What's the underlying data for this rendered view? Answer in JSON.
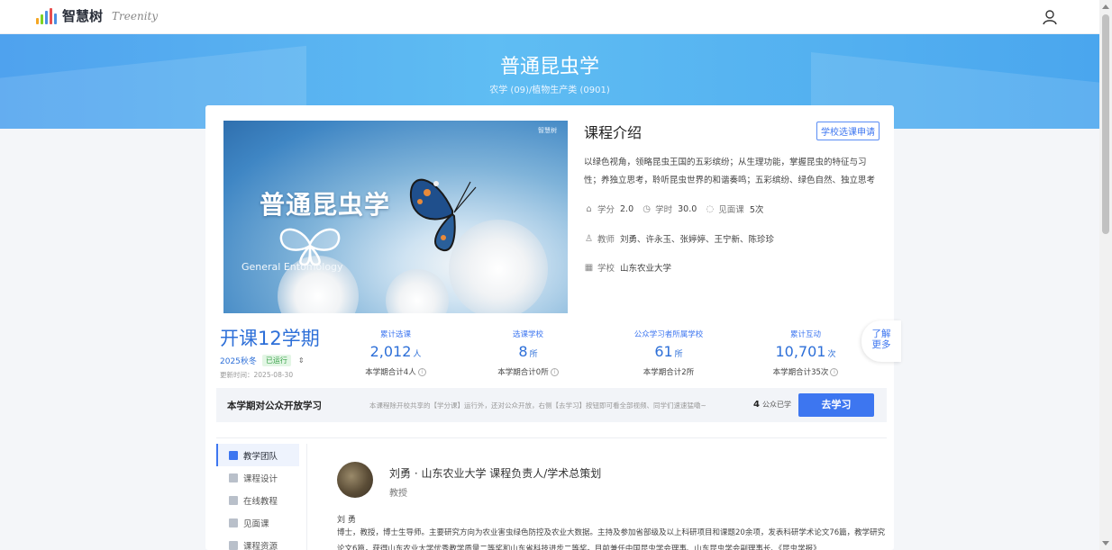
{
  "header": {
    "brand": "智慧树",
    "brand_sub": "Treenity",
    "logo_bar_colors": [
      "#f5a623",
      "#7ed321",
      "#4a90e2",
      "#e94e4e",
      "#4a90e2"
    ]
  },
  "banner": {
    "title": "普通昆虫学",
    "category": "农学 (09)/植物生产类 (0901)"
  },
  "course_image": {
    "watermark": "智慧树",
    "title": "普通昆虫学",
    "subtitle_en": "General Entomology"
  },
  "intro": {
    "heading": "课程介绍",
    "apply_button": "学校选课申请",
    "description": "以绿色视角，领略昆虫王国的五彩缤纷；从生理功能，掌握昆虫的特征与习性；养独立思考，聆听昆虫世界的和谐奏鸣；五彩缤纷、绿色自然、独立思考",
    "credit_label": "学分",
    "credit_value": "2.0",
    "hours_label": "学时",
    "hours_value": "30.0",
    "meeting_label": "见面课",
    "meeting_value": "5次",
    "teacher_label": "教师",
    "teachers": "刘勇、许永玉、张婷婷、王宁新、陈珍珍",
    "school_label": "学校",
    "school": "山东农业大学"
  },
  "semester": {
    "count_text": "开课12学期",
    "term": "2025秋冬",
    "status": "已运行",
    "updated": "更新时间：2025-08-30"
  },
  "stats": [
    {
      "label": "累计选课",
      "number": "2,012",
      "unit": "人",
      "foot": "本学期合计4人"
    },
    {
      "label": "选课学校",
      "number": "8",
      "unit": "所",
      "foot": "本学期合计0所"
    },
    {
      "label": "公众学习者所属学校",
      "number": "61",
      "unit": "所",
      "foot": "本学期合计2所"
    },
    {
      "label": "累计互动",
      "number": "10,701",
      "unit": "次",
      "foot": "本学期合计35次"
    }
  ],
  "more_button": "了解\n更多",
  "open_study": {
    "title": "本学期对公众开放学习",
    "description": "本课程除开校共享的【学分课】运行外，还对公众开放，右侧【去学习】按钮即可看全部视频、同学们速速猛嘞~",
    "count": "4",
    "count_suffix": "公众已学",
    "button": "去学习"
  },
  "side_nav": [
    {
      "label": "教学团队",
      "active": true
    },
    {
      "label": "课程设计",
      "active": false
    },
    {
      "label": "在线教程",
      "active": false
    },
    {
      "label": "见面课",
      "active": false
    },
    {
      "label": "课程资源",
      "active": false
    }
  ],
  "teacher": {
    "name_line": "刘勇 · 山东农业大学   课程负责人/学术总策划",
    "title": "教授",
    "short_name": "刘 勇",
    "bio": "博士，教授，博士生导师。主要研究方向为农业害虫绿色防控及农业大数据。主持及参加省部级及以上科研项目和课题20余项，发表科研学术论文76篇，教学研究论文6篇，获得山东农业大学优秀教学质量二等奖和山东省科技进步二等奖。目前兼任中国昆虫学会理事、山东昆虫学会副理事长、《昆虫学报》"
  }
}
